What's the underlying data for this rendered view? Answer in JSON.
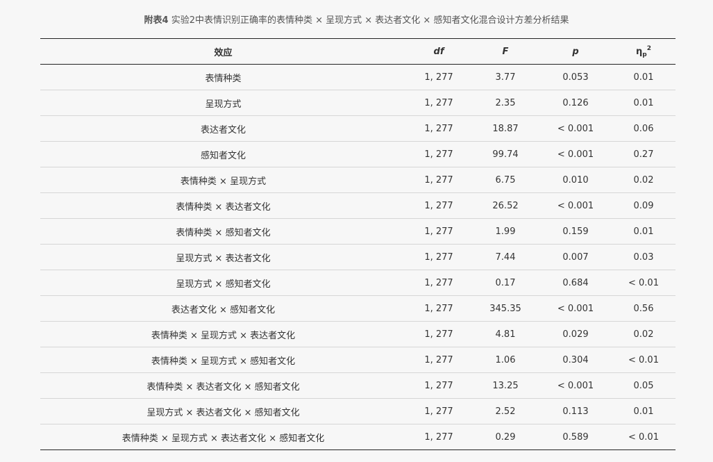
{
  "caption": {
    "label": "附表4",
    "text": " 实验2中表情识别正确率的表情种类 × 呈现方式 × 表达者文化 × 感知者文化混合设计方差分析结果"
  },
  "table": {
    "headers": {
      "effect": "效应",
      "df": "df",
      "F": "F",
      "p": "p",
      "eta_symbol": "η",
      "eta_sub": "p",
      "eta_sup": "2"
    },
    "rows": [
      {
        "effect": "表情种类",
        "df": "1, 277",
        "F": "3.77",
        "p": "0.053",
        "eta": "0.01"
      },
      {
        "effect": "呈现方式",
        "df": "1, 277",
        "F": "2.35",
        "p": "0.126",
        "eta": "0.01"
      },
      {
        "effect": "表达者文化",
        "df": "1, 277",
        "F": "18.87",
        "p": "< 0.001",
        "eta": "0.06"
      },
      {
        "effect": "感知者文化",
        "df": "1, 277",
        "F": "99.74",
        "p": "< 0.001",
        "eta": "0.27"
      },
      {
        "effect": "表情种类 × 呈现方式",
        "df": "1, 277",
        "F": "6.75",
        "p": "0.010",
        "eta": "0.02"
      },
      {
        "effect": "表情种类 × 表达者文化",
        "df": "1, 277",
        "F": "26.52",
        "p": "< 0.001",
        "eta": "0.09"
      },
      {
        "effect": "表情种类 × 感知者文化",
        "df": "1, 277",
        "F": "1.99",
        "p": "0.159",
        "eta": "0.01"
      },
      {
        "effect": "呈现方式 × 表达者文化",
        "df": "1, 277",
        "F": "7.44",
        "p": "0.007",
        "eta": "0.03"
      },
      {
        "effect": "呈现方式 × 感知者文化",
        "df": "1, 277",
        "F": "0.17",
        "p": "0.684",
        "eta": "< 0.01"
      },
      {
        "effect": "表达者文化 × 感知者文化",
        "df": "1, 277",
        "F": "345.35",
        "p": "< 0.001",
        "eta": "0.56"
      },
      {
        "effect": "表情种类 × 呈现方式 × 表达者文化",
        "df": "1, 277",
        "F": "4.81",
        "p": "0.029",
        "eta": "0.02"
      },
      {
        "effect": "表情种类 × 呈现方式 × 感知者文化",
        "df": "1, 277",
        "F": "1.06",
        "p": "0.304",
        "eta": "< 0.01"
      },
      {
        "effect": "表情种类 × 表达者文化 × 感知者文化",
        "df": "1, 277",
        "F": "13.25",
        "p": "< 0.001",
        "eta": "0.05"
      },
      {
        "effect": "呈现方式 × 表达者文化 × 感知者文化",
        "df": "1, 277",
        "F": "2.52",
        "p": "0.113",
        "eta": "0.01"
      },
      {
        "effect": "表情种类 × 呈现方式 × 表达者文化 × 感知者文化",
        "df": "1, 277",
        "F": "0.29",
        "p": "0.589",
        "eta": "< 0.01"
      }
    ]
  }
}
